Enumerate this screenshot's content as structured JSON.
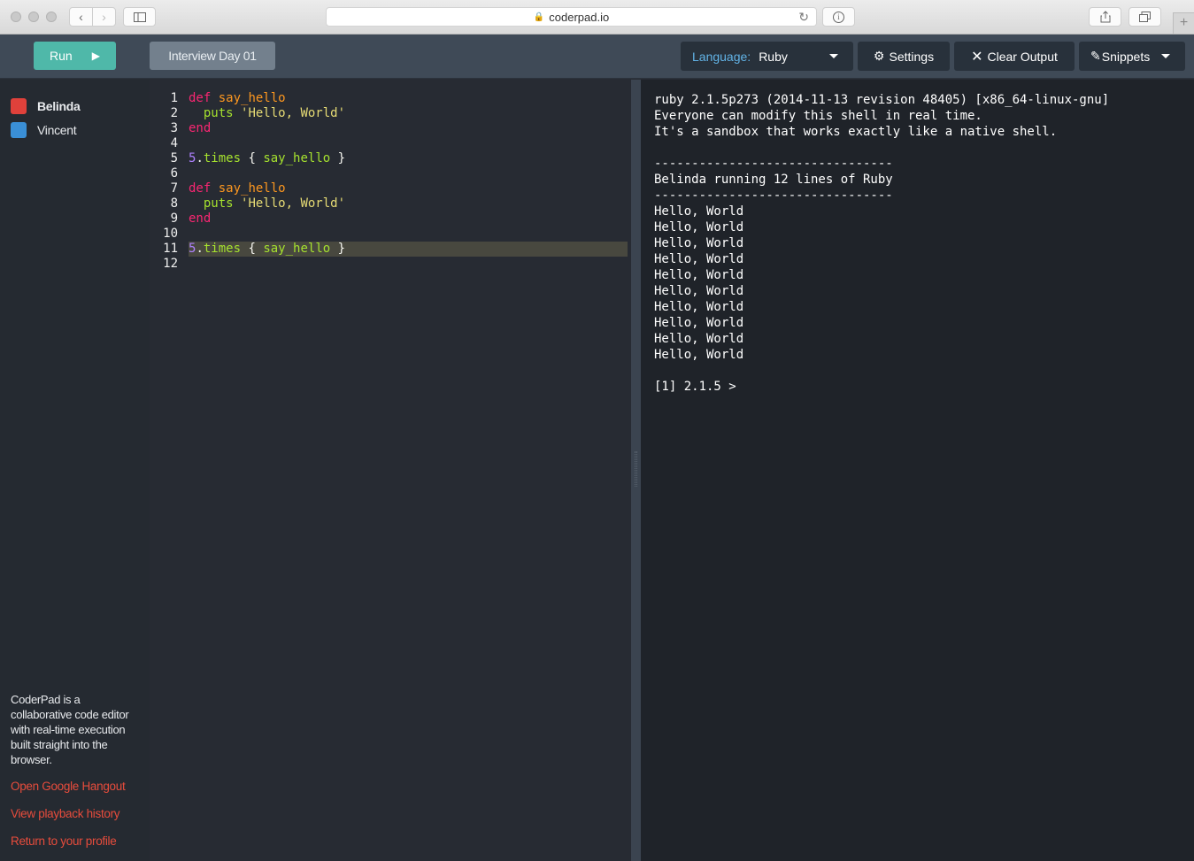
{
  "browser": {
    "url": "coderpad.io"
  },
  "toolbar": {
    "run_label": "Run",
    "pad_title": "Interview Day 01",
    "language_label": "Language:",
    "language_value": "Ruby",
    "settings_label": "Settings",
    "clear_output_label": "Clear Output",
    "snippets_label": "Snippets"
  },
  "sidebar": {
    "users": [
      {
        "name": "Belinda",
        "color": "#e0413b"
      },
      {
        "name": "Vincent",
        "color": "#3a8fd6"
      }
    ],
    "about": "CoderPad is a collaborative code editor with real-time execution built straight into the browser.",
    "links": [
      "Open Google Hangout",
      "View playback history",
      "Return to your profile"
    ]
  },
  "editor": {
    "line_numbers": [
      "1",
      "2",
      "3",
      "4",
      "5",
      "6",
      "7",
      "8",
      "9",
      "10",
      "11",
      "12"
    ],
    "lines": [
      "def say_hello",
      "  puts 'Hello, World'",
      "end",
      "",
      "5.times { say_hello }",
      "",
      "def say_hello",
      "  puts 'Hello, World'",
      "end",
      "",
      "5.times { say_hello }",
      ""
    ],
    "active_line": 11
  },
  "output": {
    "lines": [
      "ruby 2.1.5p273 (2014-11-13 revision 48405) [x86_64-linux-gnu]",
      "Everyone can modify this shell in real time.",
      "It's a sandbox that works exactly like a native shell.",
      "",
      "--------------------------------",
      "Belinda running 12 lines of Ruby",
      "--------------------------------",
      "Hello, World",
      "Hello, World",
      "Hello, World",
      "Hello, World",
      "Hello, World",
      "Hello, World",
      "Hello, World",
      "Hello, World",
      "Hello, World",
      "Hello, World",
      "",
      "[1] 2.1.5 > "
    ]
  }
}
